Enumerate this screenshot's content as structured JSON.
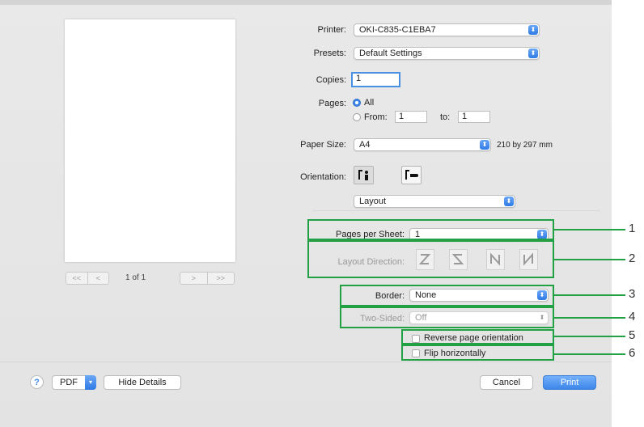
{
  "pager": {
    "first_label": "<<",
    "prev_label": "<",
    "page_status": "1 of 1",
    "next_label": ">",
    "last_label": ">>"
  },
  "printer": {
    "label": "Printer:",
    "value": "OKI-C835-C1EBA7"
  },
  "presets": {
    "label": "Presets:",
    "value": "Default Settings"
  },
  "copies": {
    "label": "Copies:",
    "value": "1"
  },
  "pages": {
    "label": "Pages:",
    "all_label": "All",
    "from_label": "From:",
    "from_value": "1",
    "to_label": "to:",
    "to_value": "1",
    "selected": "All"
  },
  "paper": {
    "label": "Paper Size:",
    "value": "A4",
    "dims": "210 by 297 mm"
  },
  "orientation": {
    "label": "Orientation:",
    "selected": "portrait"
  },
  "section": {
    "value": "Layout"
  },
  "layout": {
    "pages_per_sheet_label": "Pages per Sheet:",
    "pages_per_sheet_value": "1",
    "direction_label": "Layout Direction:",
    "border_label": "Border:",
    "border_value": "None",
    "two_sided_label": "Two-Sided:",
    "two_sided_value": "Off",
    "reverse_label": "Reverse page orientation",
    "reverse_checked": false,
    "flip_label": "Flip horizontally",
    "flip_checked": false
  },
  "footer": {
    "help_label": "?",
    "pdf_label": "PDF",
    "hide_details_label": "Hide Details",
    "cancel_label": "Cancel",
    "print_label": "Print"
  },
  "callouts": [
    "1",
    "2",
    "3",
    "4",
    "5",
    "6"
  ],
  "colors": {
    "highlight": "#22a044",
    "accent": "#3d86e8"
  }
}
